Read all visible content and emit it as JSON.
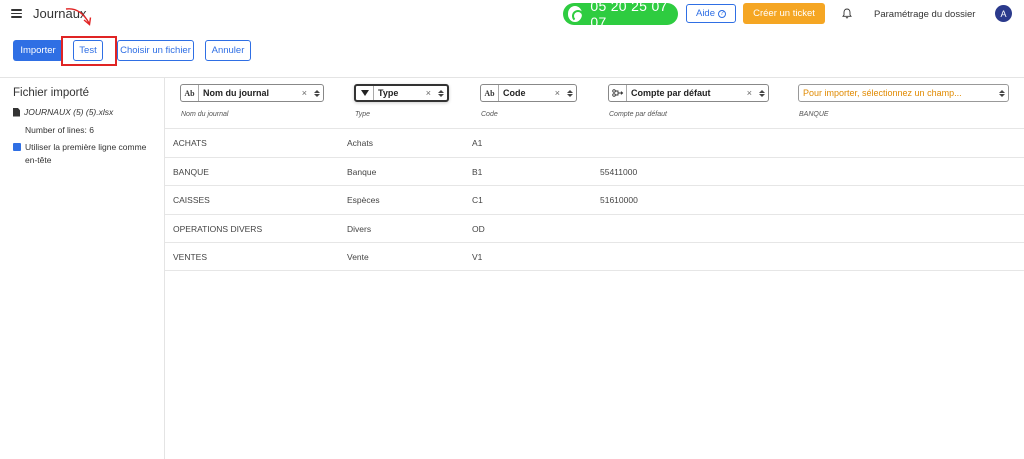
{
  "header": {
    "title": "Journaux",
    "phone": "05 20 25 07 07",
    "help_label": "Aide",
    "help_icon": "question-circle-icon",
    "ticket_label": "Créer un ticket",
    "settings_label": "Paramétrage du dossier",
    "avatar_initial": "A"
  },
  "toolbar": {
    "import_label": "Importer",
    "test_label": "Test",
    "choose_file_label": "Choisir un fichier",
    "cancel_label": "Annuler"
  },
  "left_panel": {
    "title": "Fichier importé",
    "file_name": "JOURNAUX (5) (5).xlsx",
    "lines": "Number of lines: 6",
    "header_checkbox_label": "Utiliser la première ligne comme en-tête",
    "header_checkbox_checked": true
  },
  "mapping": {
    "fields": [
      {
        "icon": "Ab",
        "label": "Nom du journal",
        "sub": "Nom du journal"
      },
      {
        "icon": "filter",
        "label": "Type",
        "sub": "Type"
      },
      {
        "icon": "Ab",
        "label": "Code",
        "sub": "Code"
      },
      {
        "icon": "link",
        "label": "Compte par défaut",
        "sub": "Compte par défaut"
      },
      {
        "icon": "",
        "label": "Pour importer, sélectionnez un champ...",
        "sub": "BANQUE"
      }
    ]
  },
  "rows": [
    [
      "ACHATS",
      "Achats",
      "A1",
      ""
    ],
    [
      "BANQUE",
      "Banque",
      "B1",
      "55411000"
    ],
    [
      "CAISSES",
      "Espèces",
      "C1",
      "51610000"
    ],
    [
      "OPERATIONS DIVERS",
      "Divers",
      "OD",
      ""
    ],
    [
      "VENTES",
      "Vente",
      "V1",
      ""
    ]
  ],
  "colors": {
    "primary": "#2f6fe4",
    "phone_green": "#2ecc40",
    "ticket_orange": "#f5a623",
    "placeholder_orange": "#e08a00",
    "highlight_red": "#e02424"
  }
}
